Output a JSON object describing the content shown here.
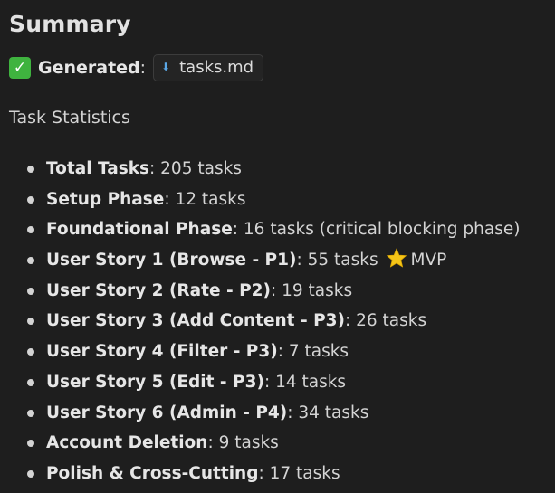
{
  "heading": "Summary",
  "generated": {
    "label": "Generated",
    "colon": ":",
    "file": "tasks.md",
    "check_icon": "check-mark-icon",
    "file_icon": "download-arrow-icon"
  },
  "stats_title": "Task Statistics",
  "items": [
    {
      "label": "Total Tasks",
      "sep": ": ",
      "value": "205 tasks"
    },
    {
      "label": "Setup Phase",
      "sep": ": ",
      "value": "12 tasks"
    },
    {
      "label": "Foundational Phase",
      "sep": ": ",
      "value": "16 tasks (critical blocking phase)"
    },
    {
      "label": "User Story 1 (Browse - P1)",
      "sep": ": ",
      "value": "55 tasks",
      "extra": "MVP"
    },
    {
      "label": "User Story 2 (Rate - P2)",
      "sep": ": ",
      "value": "19 tasks"
    },
    {
      "label": "User Story 3 (Add Content - P3)",
      "sep": ": ",
      "value": "26 tasks"
    },
    {
      "label": "User Story 4 (Filter - P3)",
      "sep": ": ",
      "value": "7 tasks"
    },
    {
      "label": "User Story 5 (Edit - P3)",
      "sep": ": ",
      "value": "14 tasks"
    },
    {
      "label": "User Story 6 (Admin - P4)",
      "sep": ": ",
      "value": "34 tasks"
    },
    {
      "label": "Account Deletion",
      "sep": ": ",
      "value": "9 tasks"
    },
    {
      "label": "Polish & Cross-Cutting",
      "sep": ": ",
      "value": "17 tasks"
    }
  ],
  "colors": {
    "background": "#1e1e1e",
    "text": "#d4d4d4",
    "check": "#3fb33f",
    "file_icon": "#5aa7e6",
    "star": "#f5c518"
  }
}
